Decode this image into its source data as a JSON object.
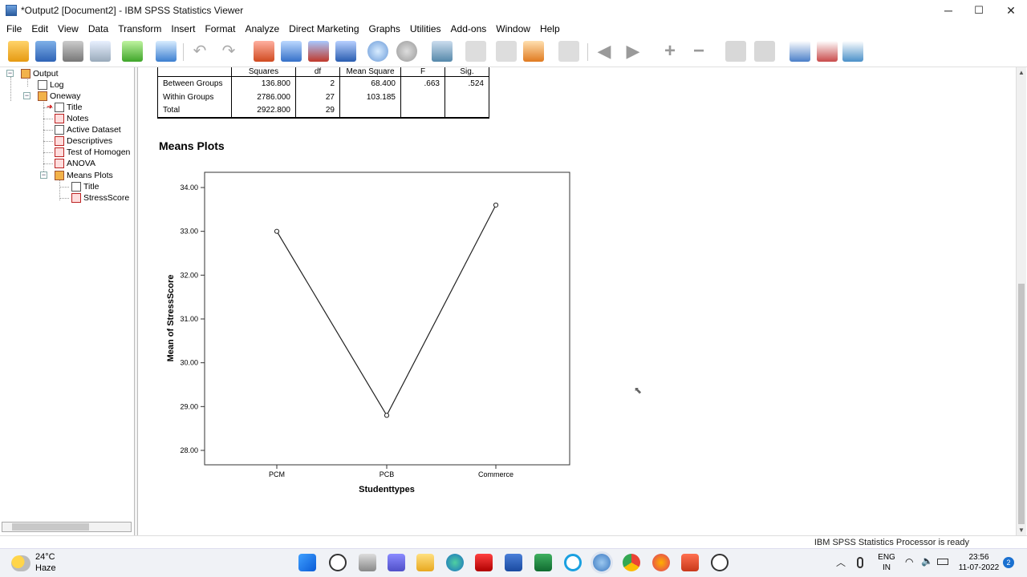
{
  "window": {
    "title": "*Output2 [Document2] - IBM SPSS Statistics Viewer"
  },
  "window_controls": {
    "minimize": "─",
    "maximize": "☐",
    "close": "✕"
  },
  "menu": [
    "File",
    "Edit",
    "View",
    "Data",
    "Transform",
    "Insert",
    "Format",
    "Analyze",
    "Direct Marketing",
    "Graphs",
    "Utilities",
    "Add-ons",
    "Window",
    "Help"
  ],
  "outline": {
    "items": [
      {
        "label": "Output",
        "icon": "output-book-icon"
      },
      {
        "label": "Log",
        "icon": "log-page-icon"
      },
      {
        "label": "Oneway",
        "icon": "procedure-book-icon"
      },
      {
        "label": "Title",
        "icon": "title-page-icon"
      },
      {
        "label": "Notes",
        "icon": "notes-icon"
      },
      {
        "label": "Active Dataset",
        "icon": "dataset-icon"
      },
      {
        "label": "Descriptives",
        "icon": "table-icon"
      },
      {
        "label": "Test of Homogen",
        "icon": "table-icon"
      },
      {
        "label": "ANOVA",
        "icon": "table-icon"
      },
      {
        "label": "Means Plots",
        "icon": "chart-book-icon"
      },
      {
        "label": "Title",
        "icon": "title-page-icon"
      },
      {
        "label": "StressScore",
        "icon": "chart-icon"
      }
    ]
  },
  "anova": {
    "headers": [
      "",
      "Squares",
      "df",
      "Mean Square",
      "F",
      "Sig."
    ],
    "rows": [
      [
        "Between Groups",
        "136.800",
        "2",
        "68.400",
        ".663",
        ".524"
      ],
      [
        "Within Groups",
        "2786.000",
        "27",
        "103.185",
        "",
        ""
      ],
      [
        "Total",
        "2922.800",
        "29",
        "",
        "",
        ""
      ]
    ]
  },
  "means_plots": {
    "title": "Means Plots"
  },
  "chart_data": {
    "type": "line",
    "categories": [
      "PCM",
      "PCB",
      "Commerce"
    ],
    "values": [
      33.0,
      28.8,
      33.6
    ],
    "xlabel": "Studenttypes",
    "ylabel": "Mean of StressScore",
    "ylim": [
      28.0,
      34.0
    ],
    "yticks": [
      "28.00",
      "29.00",
      "30.00",
      "31.00",
      "32.00",
      "33.00",
      "34.00"
    ],
    "line_color": "#222222",
    "grid": false
  },
  "status": {
    "text": "IBM SPSS Statistics Processor is ready"
  },
  "taskbar": {
    "temperature": "24°C",
    "weather": "Haze",
    "lang_top": "ENG",
    "lang_bottom": "IN",
    "time": "23:56",
    "date": "11-07-2022",
    "notif_count": "2"
  }
}
